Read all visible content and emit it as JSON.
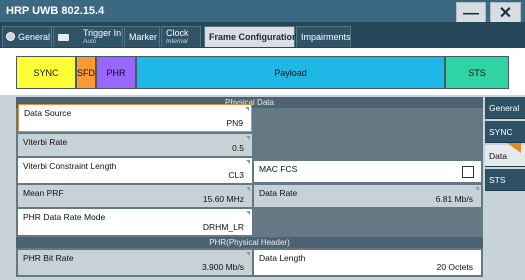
{
  "window": {
    "title": "HRP UWB 802.15.4",
    "minimize": "—",
    "close": "✕"
  },
  "tabs": [
    {
      "label": "General",
      "icon": "settings-icon"
    },
    {
      "label": "Trigger In",
      "sub": "Auto",
      "icon": "trigger-icon"
    },
    {
      "label": "Marker"
    },
    {
      "label": "Clock",
      "sub": "Internal"
    },
    {
      "label": "Frame Configuration",
      "active": true
    },
    {
      "label": "Impairments"
    }
  ],
  "frame": {
    "segments": [
      {
        "label": "SYNC",
        "color": "#ffff33"
      },
      {
        "label": "SFD",
        "color": "#ff9933"
      },
      {
        "label": "PHR",
        "color": "#9966ff"
      },
      {
        "label": "Payload",
        "color": "#1fb8e6"
      },
      {
        "label": "STS",
        "color": "#2fd3a6"
      }
    ]
  },
  "physical_data": {
    "header": "Physical Data",
    "data_source": {
      "label": "Data Source",
      "value": "PN9"
    },
    "viterbi_rate": {
      "label": "Viterbi Rate",
      "value": "0.5"
    },
    "viterbi_constraint": {
      "label": "Viterbi Constraint Length",
      "value": "CL3"
    },
    "mac_fcs": {
      "label": "MAC FCS",
      "checked": false
    },
    "mean_prf": {
      "label": "Mean PRF",
      "value": "15.60 MHz"
    },
    "data_rate": {
      "label": "Data Rate",
      "value": "6.81 Mb/s"
    },
    "phr_mode": {
      "label": "PHR Data Rate Mode",
      "value": "DRHM_LR"
    }
  },
  "phr": {
    "header": "PHR(Physical Header)",
    "bit_rate": {
      "label": "PHR Bit Rate",
      "value": "3.900 Mb/s"
    },
    "data_length": {
      "label": "Data Length",
      "value": "20 Octets"
    }
  },
  "side_tabs": [
    {
      "label": "General"
    },
    {
      "label": "SYNC"
    },
    {
      "label": "Data",
      "active": true
    },
    {
      "label": "STS"
    }
  ]
}
